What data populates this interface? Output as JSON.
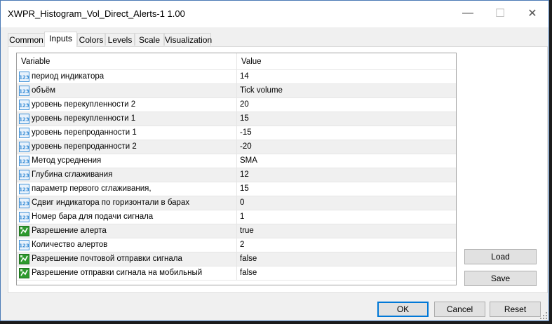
{
  "window": {
    "title": "XWPR_Histogram_Vol_Direct_Alerts-1 1.00"
  },
  "titlebar": {
    "minimize": "—",
    "maximize": "☐",
    "close": "✕"
  },
  "tabs": [
    {
      "label": "Common"
    },
    {
      "label": "Inputs",
      "active": true
    },
    {
      "label": "Colors"
    },
    {
      "label": "Levels"
    },
    {
      "label": "Scale"
    },
    {
      "label": "Visualization"
    }
  ],
  "grid": {
    "headers": {
      "variable": "Variable",
      "value": "Value"
    },
    "rows": [
      {
        "icon": "numeric-123-icon",
        "variable": "период индикатора",
        "value": "14"
      },
      {
        "icon": "numeric-123-icon",
        "variable": "объём",
        "value": "Tick volume"
      },
      {
        "icon": "numeric-123-icon",
        "variable": "уровень перекупленности 2",
        "value": "20"
      },
      {
        "icon": "numeric-123-icon",
        "variable": "уровень перекупленности 1",
        "value": "15"
      },
      {
        "icon": "numeric-123-icon",
        "variable": "уровень перепроданности 1",
        "value": "-15"
      },
      {
        "icon": "numeric-123-icon",
        "variable": "уровень перепроданности 2",
        "value": "-20"
      },
      {
        "icon": "numeric-123-icon",
        "variable": "Метод усреднения",
        "value": "SMA"
      },
      {
        "icon": "numeric-123-icon",
        "variable": "Глубина сглаживания",
        "value": "12"
      },
      {
        "icon": "numeric-123-icon",
        "variable": "параметр первого сглаживания,",
        "value": "15"
      },
      {
        "icon": "numeric-123-icon",
        "variable": "Сдвиг индикатора по горизонтали в барах",
        "value": "0"
      },
      {
        "icon": "numeric-123-icon",
        "variable": "Номер бара для подачи сигнала",
        "value": "1"
      },
      {
        "icon": "boolean-flag-icon",
        "variable": "Разрешение алерта",
        "value": "true"
      },
      {
        "icon": "numeric-123-icon",
        "variable": "Количество алертов",
        "value": "2"
      },
      {
        "icon": "boolean-flag-icon",
        "variable": "Разрешение почтовой отправки сигнала",
        "value": "false"
      },
      {
        "icon": "boolean-flag-icon",
        "variable": "Разрешение отправки сигнала на мобильный",
        "value": "false"
      }
    ]
  },
  "side_buttons": {
    "load": "Load",
    "save": "Save"
  },
  "footer_buttons": {
    "ok": "OK",
    "cancel": "Cancel",
    "reset": "Reset"
  },
  "colors": {
    "accent": "#0078d7",
    "int_icon": "#3c8fd6",
    "bool_icon": "#2e9a2e"
  }
}
